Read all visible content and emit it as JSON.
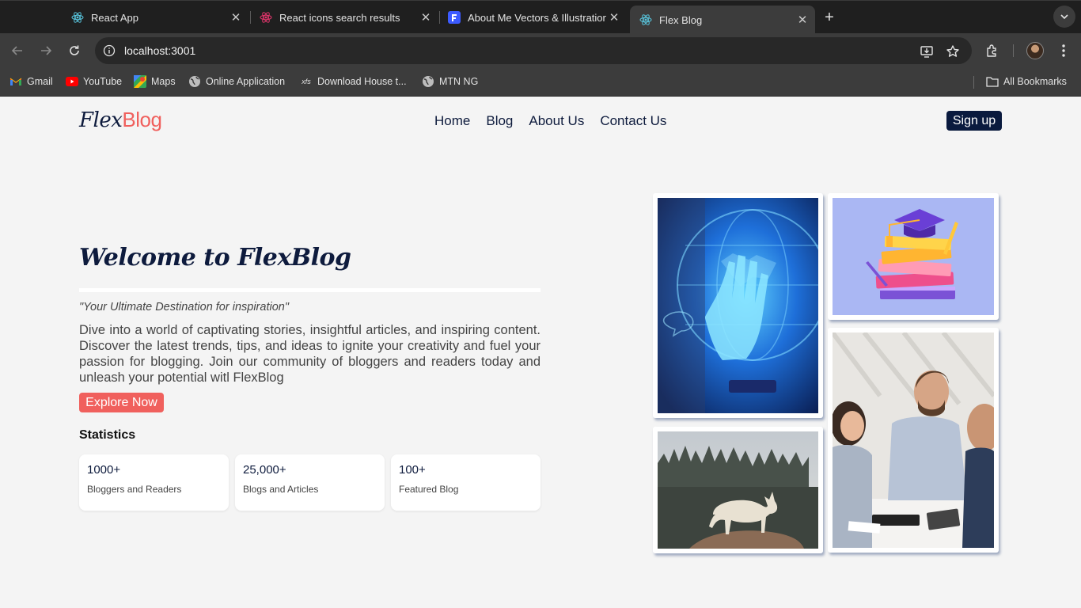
{
  "browser": {
    "tabs": [
      {
        "title": "React App",
        "favicon": "react-icon",
        "active": false
      },
      {
        "title": "React icons search results",
        "favicon": "react-icons-icon",
        "active": false
      },
      {
        "title": "About Me Vectors & Illustrations",
        "favicon": "freepik-icon",
        "active": false
      },
      {
        "title": "Flex Blog",
        "favicon": "react-icon",
        "active": true
      }
    ],
    "url": "localhost:3001",
    "bookmarks": [
      {
        "label": "Gmail",
        "icon": "gmail-icon"
      },
      {
        "label": "YouTube",
        "icon": "youtube-icon"
      },
      {
        "label": "Maps",
        "icon": "maps-icon"
      },
      {
        "label": "Online Application",
        "icon": "globe-icon"
      },
      {
        "label": "Download House t...",
        "icon": "xfs-icon"
      },
      {
        "label": "MTN NG",
        "icon": "globe-icon"
      }
    ],
    "all_bookmarks": "All Bookmarks"
  },
  "site": {
    "logo_part1": "Flex",
    "logo_part2": "Blog",
    "nav": [
      "Home",
      "Blog",
      "About Us",
      "Contact Us"
    ],
    "signup": "Sign up"
  },
  "hero": {
    "title": "Welcome to FlexBlog",
    "tagline": "\"Your Ultimate Destination for inspiration\"",
    "description": "Dive into a world of captivating stories, insightful articles, and inspiring content. Discover the latest trends, tips, and ideas to ignite your creativity and fuel your passion for blogging. Join our community of bloggers and readers today and unleash your potential witl FlexBlog",
    "cta": "Explore Now",
    "stats_heading": "Statistics",
    "stats": [
      {
        "value": "1000+",
        "label": "Bloggers and Readers"
      },
      {
        "value": "25,000+",
        "label": "Blogs and Articles"
      },
      {
        "value": "100+",
        "label": "Featured Blog"
      }
    ]
  },
  "gallery": [
    {
      "name": "digital-hand-photo",
      "alt": "hand touching digital globe"
    },
    {
      "name": "graduation-books-photo",
      "alt": "graduation cap on stack of books"
    },
    {
      "name": "wolf-photo",
      "alt": "white wolf standing on rock"
    },
    {
      "name": "team-meeting-photo",
      "alt": "team working at a desk"
    }
  ],
  "colors": {
    "accent": "#f0605d",
    "navy": "#0e1b3d",
    "page_bg": "#f4f4f4"
  }
}
